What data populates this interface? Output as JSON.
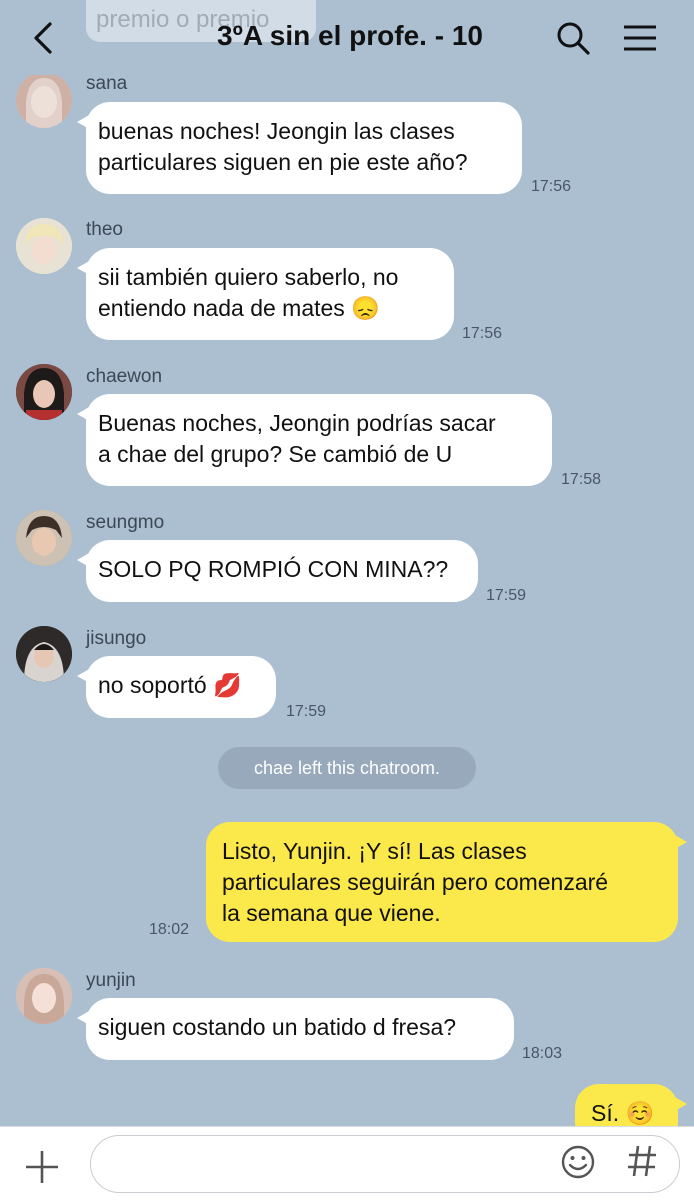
{
  "header": {
    "title": "3ºA sin el profe. - 10",
    "prev_snippet": "premio o premio"
  },
  "messages": [
    {
      "sender": "sana",
      "text": "buenas noches! Jeongin las clases\nparticulares siguen en pie este año?",
      "time": "17:56",
      "avatar_color": "#d9c2b8"
    },
    {
      "sender": "theo",
      "text": "sii también quiero saberlo, no\nentiendo nada de mates 😞",
      "time": "17:56",
      "avatar_color": "#e8dcc8"
    },
    {
      "sender": "chaewon",
      "text": "Buenas noches, Jeongin podrías sacar\na chae del grupo? Se cambió de U",
      "time": "17:58",
      "avatar_color": "#5a3b3b"
    },
    {
      "sender": "seungmo",
      "text": "SOLO PQ ROMPIÓ CON MINA??",
      "time": "17:59",
      "avatar_color": "#a69584"
    },
    {
      "sender": "jisungo",
      "text": "no soportó 💋",
      "time": "17:59",
      "avatar_color": "#4f4a4a"
    },
    {
      "system": "chae left this chatroom."
    },
    {
      "sender": "me",
      "text": "Listo, Yunjin. ¡Y sí! Las clases\nparticulares seguirán pero comenzaré\nla semana que viene.",
      "time": "18:02"
    },
    {
      "sender": "yunjin",
      "text": "siguen costando un batido d fresa?",
      "time": "18:03",
      "avatar_color": "#e2c9c0"
    },
    {
      "sender": "me",
      "text": "Sí. ☺️"
    }
  ],
  "input": {
    "placeholder": ""
  },
  "icons": {
    "back": "chevron-left-icon",
    "search": "search-icon",
    "menu": "hamburger-icon",
    "plus": "plus-icon",
    "emoji": "smiley-icon",
    "hash": "hashtag-icon"
  },
  "colors": {
    "background": "#abbfd1",
    "my_bubble": "#fbe84a",
    "their_bubble": "#ffffff"
  }
}
